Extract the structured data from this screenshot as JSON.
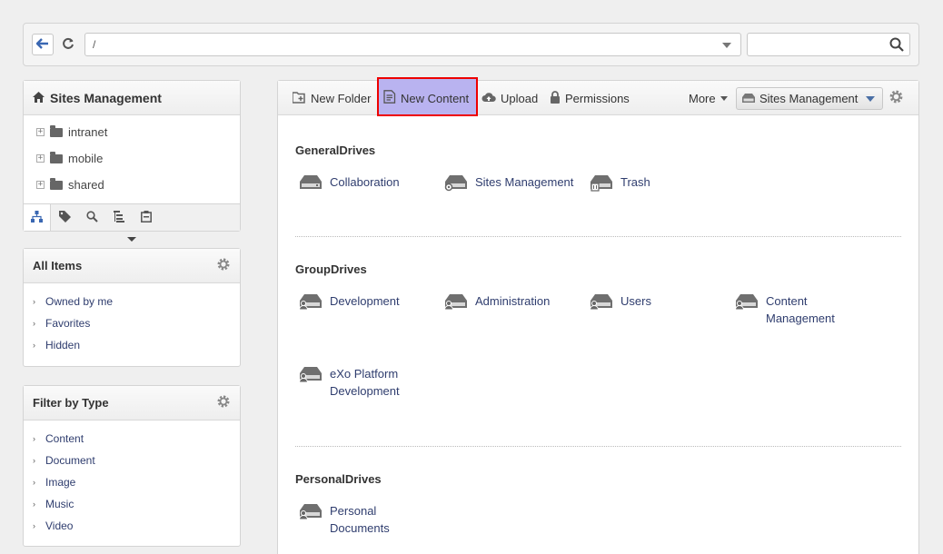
{
  "address_bar": {
    "path": "/",
    "search_placeholder": ""
  },
  "sites_panel": {
    "title": "Sites Management",
    "tree": [
      {
        "label": "intranet"
      },
      {
        "label": "mobile"
      },
      {
        "label": "shared"
      }
    ],
    "tabs": [
      "tree-icon",
      "tag-icon",
      "search-icon",
      "hierarchy-icon",
      "clipboard-icon"
    ]
  },
  "all_items_panel": {
    "title": "All Items",
    "items": [
      "Owned by me",
      "Favorites",
      "Hidden"
    ]
  },
  "filter_panel": {
    "title": "Filter by Type",
    "items": [
      "Content",
      "Document",
      "Image",
      "Music",
      "Video"
    ]
  },
  "toolbar": {
    "new_folder": "New Folder",
    "new_content": "New Content",
    "upload": "Upload",
    "permissions": "Permissions",
    "more": "More",
    "drive_select": "Sites Management"
  },
  "sections": {
    "general": {
      "title": "GeneralDrives",
      "drives": [
        "Collaboration",
        "Sites Management",
        "Trash"
      ]
    },
    "group": {
      "title": "GroupDrives",
      "drives": [
        "Development",
        "Administration",
        "Users",
        "Content\nManagement",
        "eXo Platform\nDevelopment"
      ]
    },
    "personal": {
      "title": "PersonalDrives",
      "drives": [
        "Personal\nDocuments"
      ]
    }
  },
  "colors": {
    "highlight_border": "#e00000",
    "highlight_fill": "#b9b3f0",
    "link": "#2f3d6e"
  }
}
